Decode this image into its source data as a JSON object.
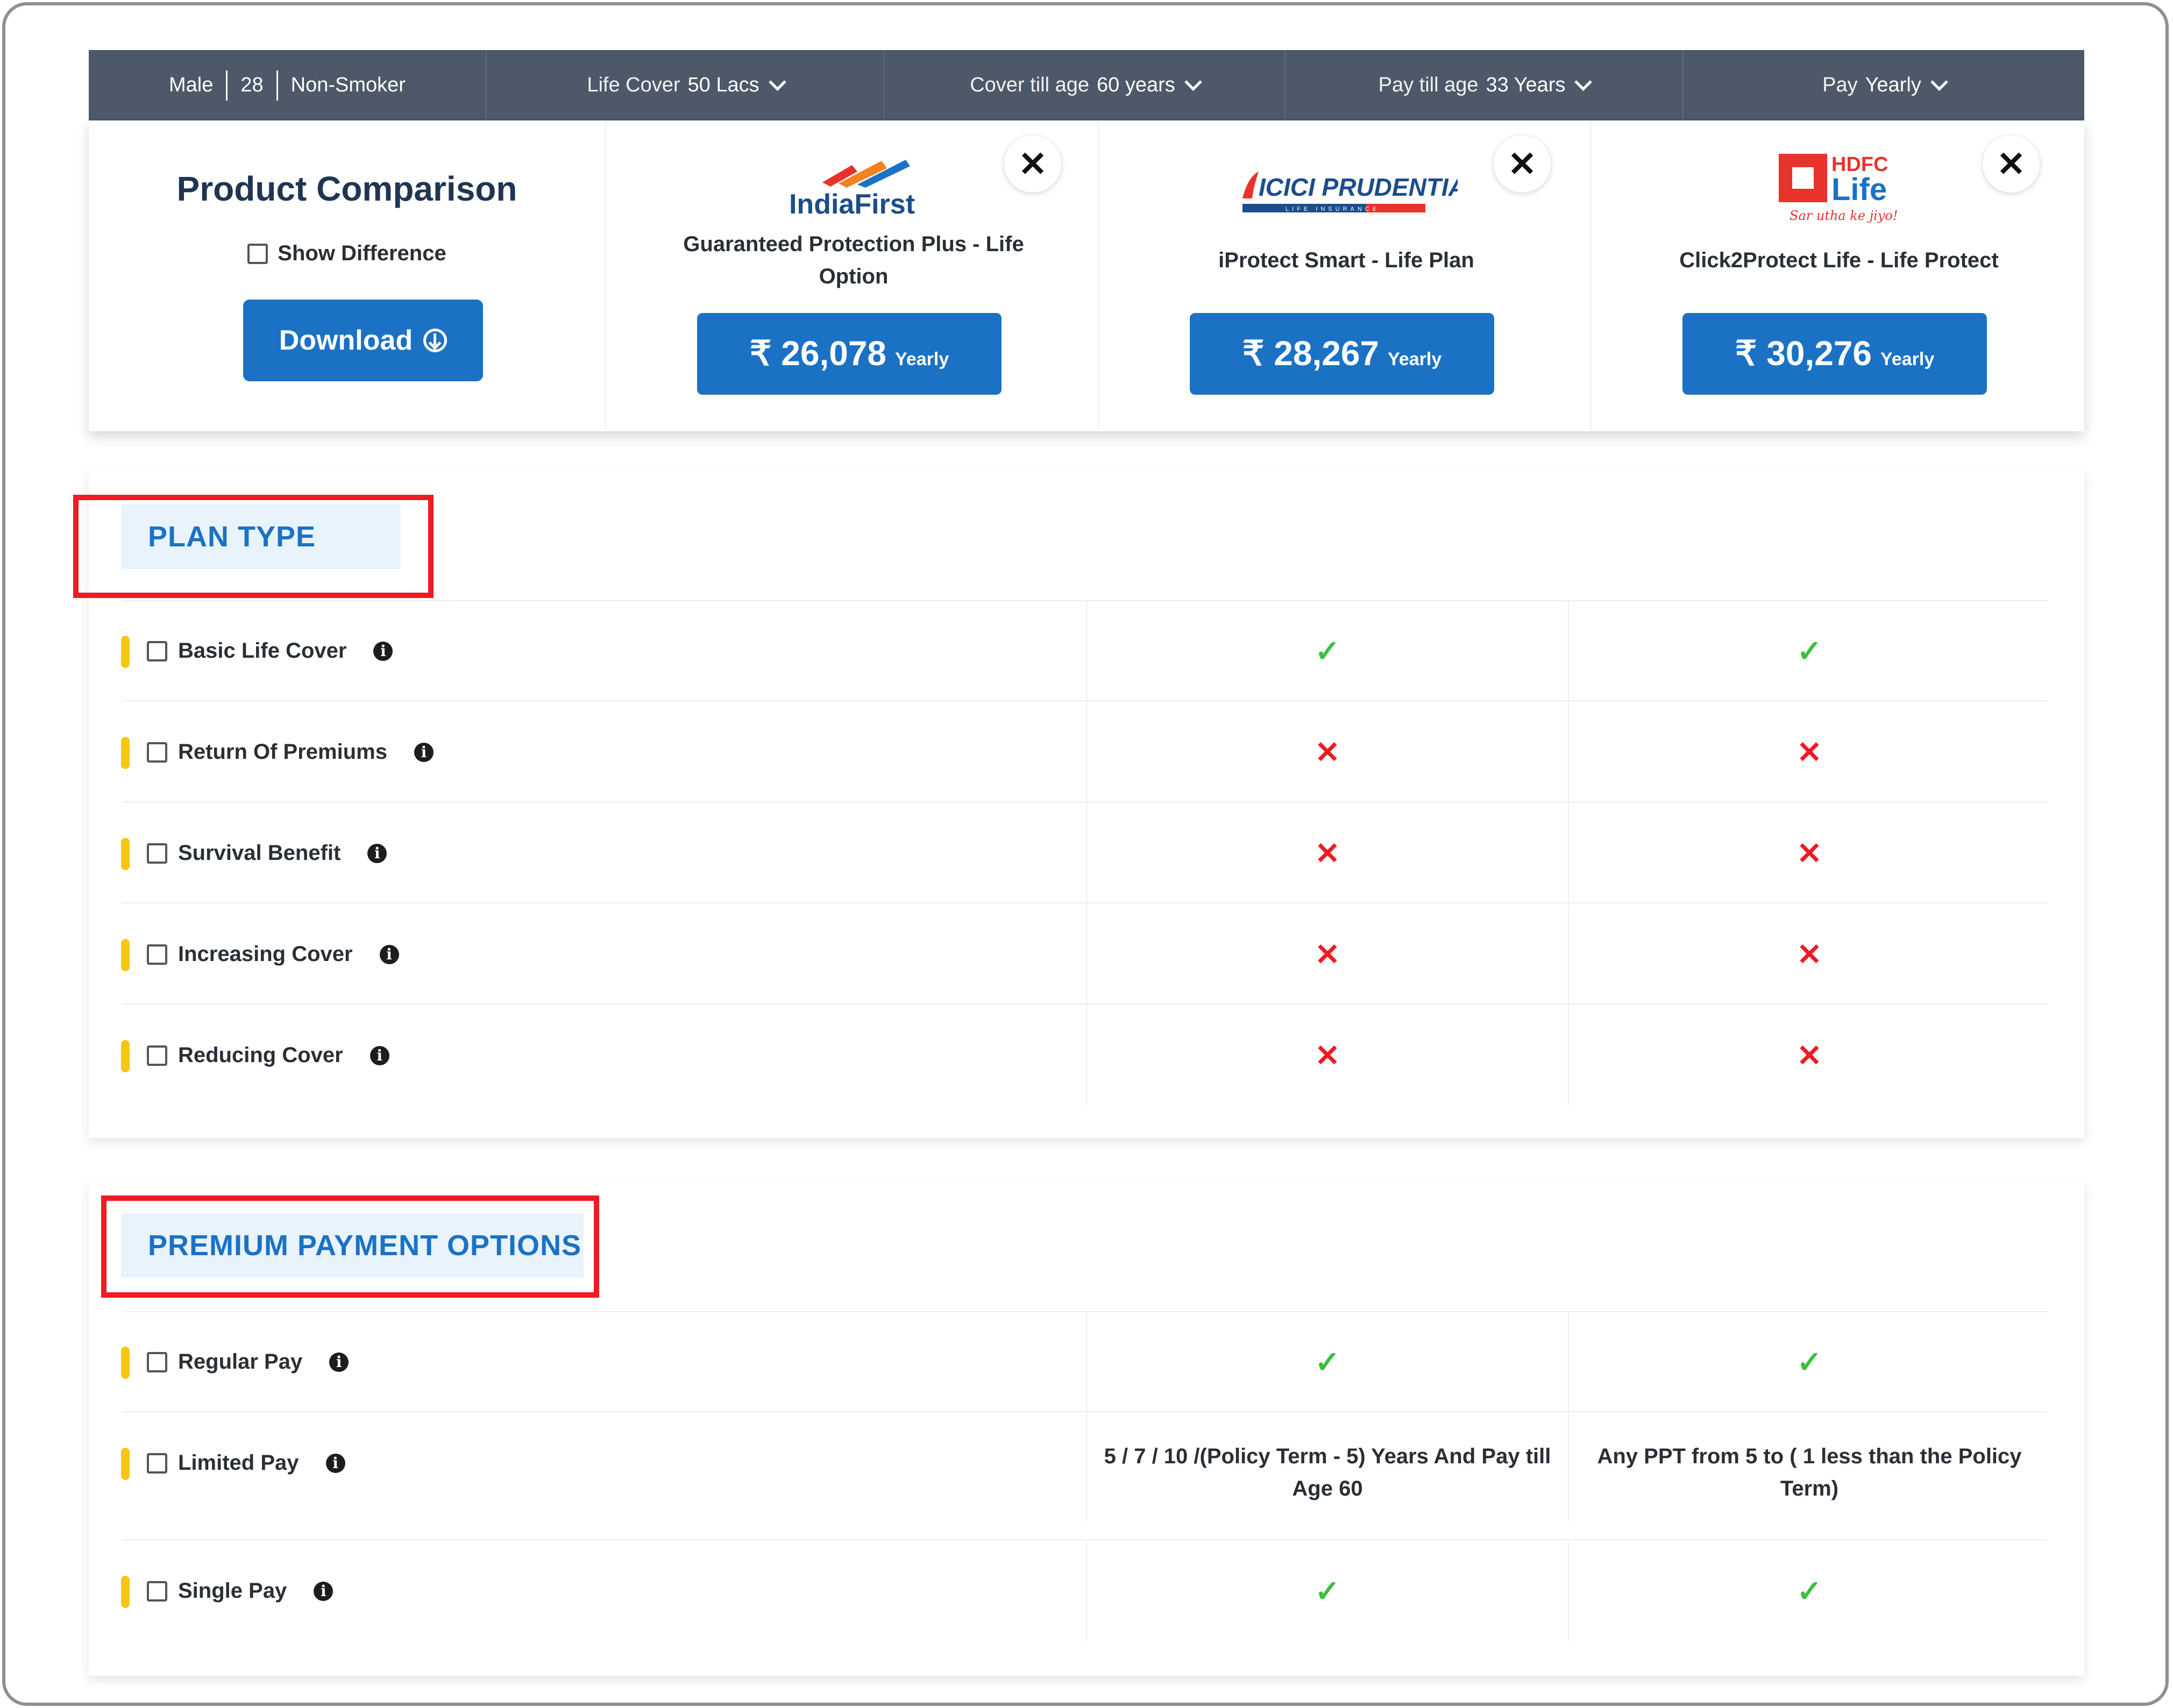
{
  "filters": {
    "gender": "Male",
    "age": "28",
    "smoker": "Non-Smoker",
    "life_cover_label": "Life Cover",
    "life_cover_value": "50 Lacs",
    "cover_till_label": "Cover till age",
    "cover_till_value": "60 years",
    "pay_till_label": "Pay till age",
    "pay_till_value": "33 Years",
    "pay_label": "Pay",
    "pay_value": "Yearly"
  },
  "compare": {
    "title": "Product Comparison",
    "show_difference": "Show Difference",
    "download": "Download",
    "close_symbol": "✕",
    "plans": [
      {
        "logo_text": "IndiaFirst",
        "name": "Guaranteed Protection Plus - Life Option",
        "price": "₹ 26,078",
        "freq": "Yearly"
      },
      {
        "logo_text": "ICICI PRUDENTIAL",
        "logo_sub": "LIFE INSURANCE",
        "name": "iProtect Smart - Life Plan",
        "price": "₹ 28,267",
        "freq": "Yearly"
      },
      {
        "logo_text": "HDFC",
        "logo_text2": "Life",
        "logo_tagline": "Sar utha ke jiyo!",
        "name": "Click2Protect Life - Life Protect",
        "price": "₹ 30,276",
        "freq": "Yearly"
      }
    ]
  },
  "plan_type": {
    "title": "PLAN TYPE",
    "rows": [
      {
        "label": "Basic Life Cover",
        "c1": "✓",
        "c2": "✓"
      },
      {
        "label": "Return Of Premiums",
        "c1": "✕",
        "c2": "✕"
      },
      {
        "label": "Survival Benefit",
        "c1": "✕",
        "c2": "✕"
      },
      {
        "label": "Increasing Cover",
        "c1": "✕",
        "c2": "✕"
      },
      {
        "label": "Reducing Cover",
        "c1": "✕",
        "c2": "✕"
      }
    ]
  },
  "premium_payment": {
    "title": "PREMIUM PAYMENT OPTIONS",
    "rows": [
      {
        "label": "Regular Pay",
        "c1": "✓",
        "c2": "✓"
      },
      {
        "label": "Limited Pay",
        "c1": "5 / 7 / 10 /(Policy Term - 5) Years And Pay till Age 60",
        "c2": "Any PPT from 5 to ( 1 less than the Policy Term)"
      },
      {
        "label": "Single Pay",
        "c1": "✓",
        "c2": "✓"
      }
    ]
  },
  "info_symbol": "i",
  "colors": {
    "accent": "#1b72c4",
    "header_bar": "#4d5968",
    "yes": "#3bbf3b",
    "no": "#ee1b24",
    "highlight": "#ee1b24",
    "marker": "#f7c613"
  }
}
